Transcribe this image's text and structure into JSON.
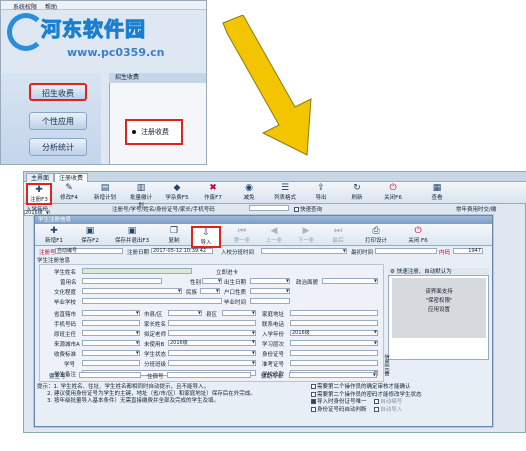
{
  "snippet": {
    "menu": [
      "系统权限",
      "帮助"
    ],
    "watermark_title": "河东软件园",
    "watermark_url": "www.pc0359.cn",
    "nav": [
      "招生收费",
      "个性应用",
      "分析统计"
    ],
    "panel_title": "招生收费",
    "register_button": "注册收费"
  },
  "window": {
    "tabs": [
      "主界面",
      "注册收费"
    ],
    "toolbar": [
      {
        "label": "注册F3",
        "icon": "plus-icon"
      },
      {
        "label": "修改F4",
        "icon": "edit-icon"
      },
      {
        "label": "新增计划",
        "icon": "plan-icon"
      },
      {
        "label": "批量缴计划",
        "icon": "batch-icon"
      },
      {
        "label": "学杂费F5",
        "icon": "fee-icon"
      },
      {
        "label": "作废F7",
        "icon": "cancel-icon"
      },
      {
        "label": "减免",
        "icon": "reduce-icon"
      },
      {
        "label": "列表格式",
        "icon": "list-icon"
      },
      {
        "label": "导出",
        "icon": "export-icon"
      },
      {
        "label": "刷新",
        "icon": "refresh-icon"
      },
      {
        "label": "关闭F6",
        "icon": "close-icon"
      },
      {
        "label": "查看",
        "icon": "view-icon"
      }
    ],
    "row2_left": "入学年份",
    "row2_year": "2016级",
    "row2_mid": "注册号/学号/姓名/身份证号/家长/手机号码",
    "row2_fast": "快速查询",
    "row2_right": "常年费用时交/缴"
  },
  "dialog": {
    "title": "学生注册信息",
    "toolbar": [
      {
        "label": "新增F1",
        "icon": "new-icon",
        "enabled": true
      },
      {
        "label": "保存F2",
        "icon": "save-icon",
        "enabled": true
      },
      {
        "label": "保存并退出F3",
        "icon": "save-exit-icon",
        "enabled": true
      },
      {
        "label": "复制",
        "icon": "copy-icon",
        "enabled": true
      },
      {
        "label": "导入",
        "icon": "import-icon",
        "enabled": true
      },
      {
        "label": "第一条",
        "icon": "first-icon",
        "enabled": false
      },
      {
        "label": "上一条",
        "icon": "prev-icon",
        "enabled": false
      },
      {
        "label": "下一条",
        "icon": "next-icon",
        "enabled": false
      },
      {
        "label": "最后",
        "icon": "last-icon",
        "enabled": false
      },
      {
        "label": "打印设计",
        "icon": "print-icon",
        "enabled": true
      },
      {
        "label": "关闭 F6",
        "icon": "close-icon",
        "enabled": true
      }
    ],
    "reg_no_label": "注册号",
    "reg_no_value": "自动编号",
    "reg_date_label": "注册日期",
    "reg_date_value": "2017-05-12 10:39:42",
    "school_label": "入校分班时间",
    "fee_label": "最初时间",
    "seq_label": "内码",
    "seq_value": "1947",
    "section": "学生注册信息",
    "fields": {
      "name": "学生姓名",
      "enroll": "立即进卡",
      "regno": "曾用名",
      "gender": "性别",
      "birth": "出生日期",
      "culture": "文化程度",
      "nation": "民族",
      "hukou": "户口性质",
      "grad": "毕业学校",
      "gradtime": "毕业时间",
      "prov": "省直辖市",
      "city": "市县/区",
      "area": "县区",
      "address": "家庭地址",
      "phone": "手机号码",
      "parent": "家长姓名",
      "contact": "联系电话",
      "class": "原班主任",
      "teacher": "拟定老师",
      "year": "入学年份",
      "year_val": "2016级",
      "exam1": "来源城市A",
      "exam2": "未使用B",
      "exam2_val": "2016级",
      "study": "学习层次",
      "pay": "收费标准",
      "status": "学生状态",
      "idcard": "身份证号",
      "major": "学号",
      "cls": "分班班级",
      "exam": "准考证号",
      "note": "学生备注",
      "school": "学校收款",
      "dorm": "寝室号",
      "bed": "住宿号",
      "aux": "辅助专业"
    },
    "side_head": "快速注册、自动默认为",
    "side_text": [
      "该界面支持",
      "\"保密权限\"",
      "应用设置"
    ],
    "tips": [
      "提示：1. 学生姓名、住址、学生姓名都相同时自动提示，且不能导入。",
      "2. 建议使用身份证号为学生的主键，地址（省/市/区）和家庭地址）保存后在外完成。",
      "3. 按年级批量导入基本条件）无需直接缴费并全部及完成的学生及填。"
    ],
    "checks": [
      {
        "label": "需要第二个操作员的确定审核才能确认",
        "on": false
      },
      {
        "label": "需要第二个操作员的密码才能修改学生状态",
        "on": false
      },
      {
        "label": "导入时身份证号唯一",
        "on": true
      },
      {
        "label": "身份证号码自动判断",
        "on": false
      },
      {
        "label": "自动编号",
        "on": false
      },
      {
        "label": "自动导入",
        "on": false
      }
    ],
    "vert_label": "信息完善"
  },
  "colors": {
    "highlight": "#e0241b",
    "arrow": "#f3c400"
  }
}
